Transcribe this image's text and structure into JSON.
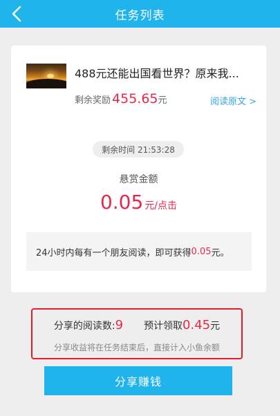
{
  "navbar": {
    "title": "任务列表",
    "back_icon": "chevron-left-icon"
  },
  "article": {
    "title": "488元还能出国看世界？原来我...",
    "reward_label": "剩余奖励",
    "reward_amount": "455.65",
    "reward_unit": "元",
    "read_link": "阅读原文 >"
  },
  "timer": {
    "text": "剩余时间 21:53:28"
  },
  "bounty": {
    "label": "悬赏金额",
    "value": "0.05",
    "unit": "元/点击"
  },
  "rule": {
    "prefix": "24小时内每有一个朋友阅读，即可获得",
    "amount": "0.05",
    "suffix": "元。"
  },
  "share_stats": {
    "reads_label": "分享的阅读数:",
    "reads_value": "9",
    "estimate_label": "预计领取",
    "estimate_value": "0.45",
    "estimate_unit": "元",
    "note": "分享收益将在任务结束后，直接计入小鱼余额"
  },
  "share_button": {
    "label": "分享赚钱"
  },
  "colors": {
    "accent": "#1fb4ec",
    "highlight": "#e8284a",
    "border_red": "#e81a2a",
    "link": "#35a8e0"
  }
}
